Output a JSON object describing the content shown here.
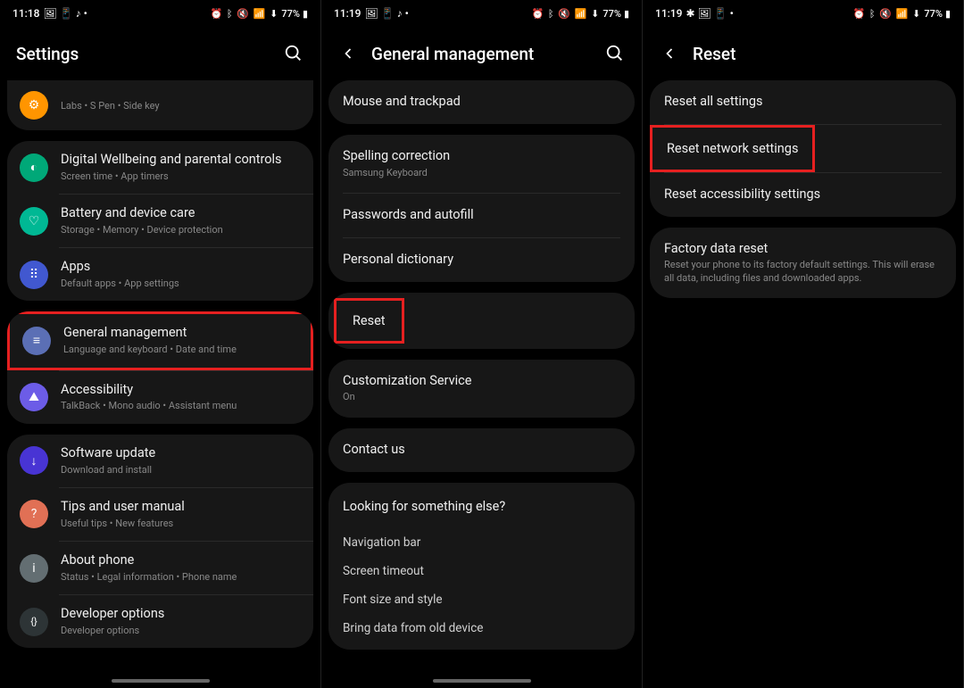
{
  "screens": [
    {
      "statusBar": {
        "time": "11:18",
        "leftIcons": "🖼 📱 ♪ •",
        "rightIcons": "⏰ ᛒ 🔇 📶 ⬇",
        "battery": "77%"
      },
      "header": {
        "title": "Settings",
        "hasBack": false,
        "hasSearch": true
      },
      "groups": [
        {
          "partial": true,
          "items": [
            {
              "icon": "⚙",
              "iconBg": "#ff9500",
              "title": "",
              "subtitle": "Labs  •  S Pen  •  Side key"
            }
          ]
        },
        {
          "items": [
            {
              "icon": "◐",
              "iconBg": "#00a878",
              "title": "Digital Wellbeing and parental controls",
              "subtitle": "Screen time  •  App timers"
            },
            {
              "icon": "♡",
              "iconBg": "#00b894",
              "title": "Battery and device care",
              "subtitle": "Storage  •  Memory  •  Device protection"
            },
            {
              "icon": "⠿",
              "iconBg": "#4158d0",
              "title": "Apps",
              "subtitle": "Default apps  •  App settings"
            }
          ]
        },
        {
          "items": [
            {
              "icon": "≡",
              "iconBg": "#5b6fb5",
              "title": "General management",
              "subtitle": "Language and keyboard  •  Date and time",
              "highlight": true
            },
            {
              "icon": "⛰",
              "iconBg": "#6c5ce7",
              "title": "Accessibility",
              "subtitle": "TalkBack  •  Mono audio  •  Assistant menu"
            }
          ]
        },
        {
          "items": [
            {
              "icon": "↓",
              "iconBg": "#4834d4",
              "title": "Software update",
              "subtitle": "Download and install"
            },
            {
              "icon": "?",
              "iconBg": "#e17055",
              "title": "Tips and user manual",
              "subtitle": "Useful tips  •  New features"
            },
            {
              "icon": "i",
              "iconBg": "#636e72",
              "title": "About phone",
              "subtitle": "Status  •  Legal information  •  Phone name"
            },
            {
              "icon": "{}",
              "iconBg": "#2d3436",
              "title": "Developer options",
              "subtitle": "Developer options"
            }
          ]
        }
      ]
    },
    {
      "statusBar": {
        "time": "11:19",
        "leftIcons": "🖼 📱 ♪ •",
        "rightIcons": "⏰ ᛒ 🔇 📶 ⬇",
        "battery": "77%"
      },
      "header": {
        "title": "General management",
        "hasBack": true,
        "hasSearch": true
      },
      "simpleGroups": [
        {
          "items": [
            {
              "title": "Mouse and trackpad"
            }
          ]
        },
        {
          "items": [
            {
              "title": "Spelling correction",
              "subtitle": "Samsung Keyboard"
            },
            {
              "title": "Passwords and autofill"
            },
            {
              "title": "Personal dictionary"
            }
          ]
        },
        {
          "items": [
            {
              "title": "Reset",
              "highlight": true
            }
          ]
        },
        {
          "items": [
            {
              "title": "Customization Service",
              "subtitle": "On"
            }
          ]
        },
        {
          "items": [
            {
              "title": "Contact us"
            }
          ]
        }
      ],
      "lookingFor": {
        "title": "Looking for something else?",
        "items": [
          "Navigation bar",
          "Screen timeout",
          "Font size and style",
          "Bring data from old device"
        ]
      }
    },
    {
      "statusBar": {
        "time": "11:19",
        "leftIcons": "✱ 🖼 📱 •",
        "rightIcons": "⏰ ᛒ 🔇 📶 ⬇",
        "battery": "77%"
      },
      "header": {
        "title": "Reset",
        "hasBack": true,
        "hasSearch": false
      },
      "simpleGroups": [
        {
          "items": [
            {
              "title": "Reset all settings"
            },
            {
              "title": "Reset network settings",
              "highlight": true
            },
            {
              "title": "Reset accessibility settings"
            }
          ]
        },
        {
          "items": [
            {
              "title": "Factory data reset",
              "subtitle": "Reset your phone to its factory default settings. This will erase all data, including files and downloaded apps."
            }
          ]
        }
      ]
    }
  ]
}
